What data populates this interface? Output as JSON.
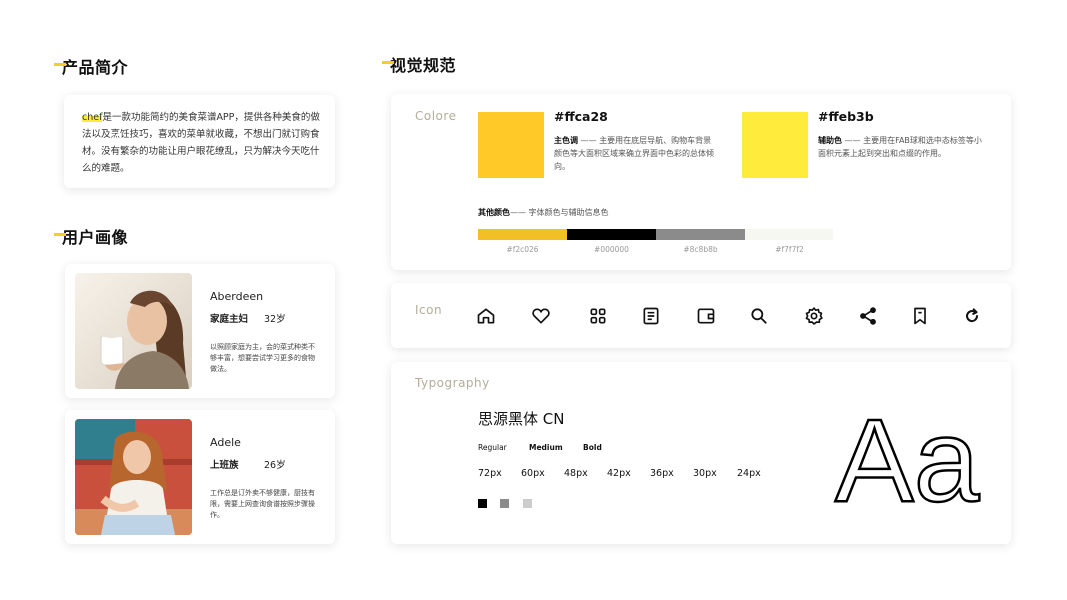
{
  "sections": {
    "product_intro": "产品简介",
    "user_persona": "用户画像",
    "visual_spec": "视觉规范"
  },
  "intro": {
    "highlight": "chef",
    "text": "是一款功能简约的美食菜谱APP，提供各种美食的做法以及烹饪技巧，喜欢的菜单就收藏，不想出门就订购食材。没有繁杂的功能让用户眼花缭乱，只为解决今天吃什么的难题。"
  },
  "users": [
    {
      "name": "Aberdeen",
      "role": "家庭主妇",
      "age": "32岁",
      "desc": "以照顾家庭为主，会的菜式种类不够丰富，想要尝试学习更多的食物做法。"
    },
    {
      "name": "Adele",
      "role": "上班族",
      "age": "26岁",
      "desc": "工作总是订外卖不够健康，厨技有限，需要上网查询食谱按照步骤操作。"
    }
  ],
  "colors": {
    "label": "Colore",
    "primary": {
      "hex": "#ffca28",
      "title": "主色调",
      "desc": "—— 主要用在底层导航、购物车背景颜色等大面积区域来确立界面中色彩的总体倾向。"
    },
    "secondary": {
      "hex": "#ffeb3b",
      "title": "辅助色",
      "desc": "—— 主要用在FAB球和选中态标签等小面积元素上起到突出和点缀的作用。"
    },
    "others_title": "其他颜色",
    "others_desc": "—— 字体颜色与辅助信息色",
    "others": [
      "#f2c026",
      "#000000",
      "#8c8b8b",
      "#f7f7f2"
    ]
  },
  "icons": {
    "label": "Icon",
    "items": [
      "home-icon",
      "heart-icon",
      "grid-icon",
      "list-document-icon",
      "wallet-icon",
      "search-icon",
      "gear-icon",
      "share-icon",
      "bookmark-icon",
      "refresh-icon"
    ]
  },
  "typography": {
    "label": "Typography",
    "font_name": "思源黑体 CN",
    "weights": [
      "Regular",
      "Medium",
      "Bold"
    ],
    "sizes": [
      "72px",
      "60px",
      "48px",
      "42px",
      "36px",
      "30px",
      "24px"
    ],
    "text_colors": [
      "#000000",
      "#8c8b8b",
      "#cccccc"
    ],
    "sample": "Aa"
  }
}
